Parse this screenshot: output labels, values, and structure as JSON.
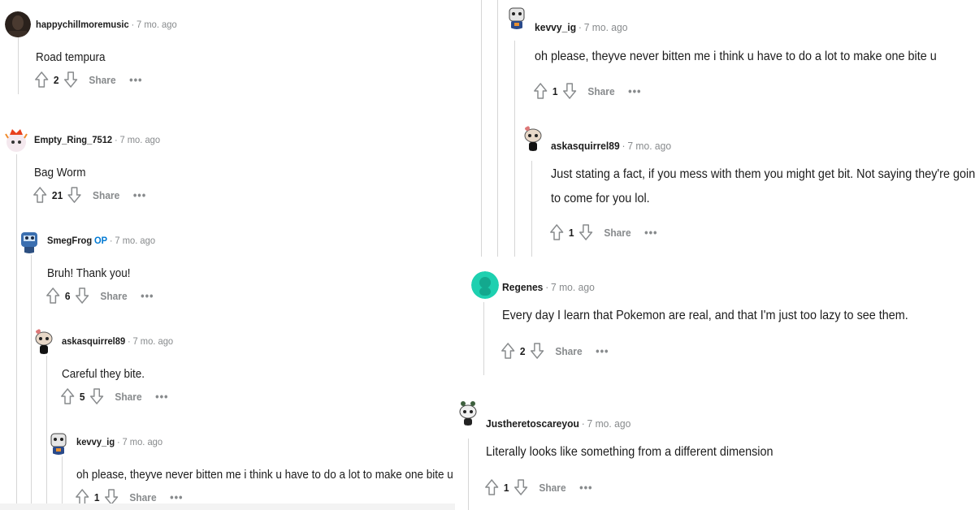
{
  "left": {
    "comments": [
      {
        "author": "happychillmoremusic",
        "op": "",
        "time": "7 mo. ago",
        "body": "Road tempura",
        "votes": "2",
        "share": "Share",
        "more": "•••",
        "avatar_icon": "dark-photo-avatar"
      },
      {
        "author": "Empty_Ring_7512",
        "op": "",
        "time": "7 mo. ago",
        "body": "Bag Worm",
        "votes": "21",
        "share": "Share",
        "more": "•••",
        "avatar_icon": "crowned-avatar"
      },
      {
        "author": "SmegFrog",
        "op": "OP",
        "time": "7 mo. ago",
        "body": "Bruh! Thank you!",
        "votes": "6",
        "share": "Share",
        "more": "•••",
        "avatar_icon": "robot-avatar"
      },
      {
        "author": "askasquirrel89",
        "op": "",
        "time": "7 mo. ago",
        "body": "Careful they bite.",
        "votes": "5",
        "share": "Share",
        "more": "•••",
        "avatar_icon": "snoo-avatar"
      },
      {
        "author": "kevvy_ig",
        "op": "",
        "time": "7 mo. ago",
        "body": "oh please, theyve never bitten me i think u have to do a lot to make one bite u",
        "votes": "1",
        "share": "Share",
        "more": "•••",
        "avatar_icon": "snoo-avatar"
      }
    ]
  },
  "right": {
    "comments": [
      {
        "author": "kevvy_ig",
        "op": "",
        "time": "7 mo. ago",
        "body": "oh please, theyve never bitten me i think u have to do a lot to make one bite u",
        "votes": "1",
        "share": "Share",
        "more": "•••",
        "avatar_icon": "snoo-avatar"
      },
      {
        "author": "askasquirrel89",
        "op": "",
        "time": "7 mo. ago",
        "body": "Just stating a fact, if you mess with them you might get bit. Not saying they're going to come for you lol.",
        "votes": "1",
        "share": "Share",
        "more": "•••",
        "avatar_icon": "snoo-avatar"
      },
      {
        "author": "Regenes",
        "op": "",
        "time": "7 mo. ago",
        "body": "Every day I learn that Pokemon are real, and that I'm just too lazy to see them.",
        "votes": "2",
        "share": "Share",
        "more": "•••",
        "avatar_icon": "teal-avatar"
      },
      {
        "author": "Justheretoscareyou",
        "op": "",
        "time": "7 mo. ago",
        "body": "Literally looks like something from a different dimension",
        "votes": "1",
        "share": "Share",
        "more": "•••",
        "avatar_icon": "snoo-avatar"
      }
    ]
  },
  "colors": {
    "text": "#1c1c1c",
    "meta": "#878a8c",
    "op": "#0079d3",
    "thread": "#d6d6d6",
    "teal": "#1ed0b0"
  }
}
